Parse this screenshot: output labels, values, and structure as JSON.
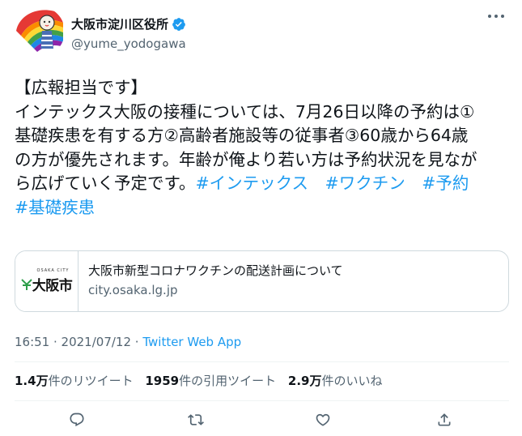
{
  "account": {
    "display_name": "大阪市淀川区役所",
    "handle": "@yume_yodogawa"
  },
  "tweet": {
    "lines": [
      [
        {
          "t": "【広報担当です】",
          "h": false
        }
      ],
      [
        {
          "t": "インテックス大阪の接種については、7月26日以降の予約は①",
          "h": false
        }
      ],
      [
        {
          "t": "基礎疾患を有する方②高齢者施設等の従事者③60歳から64歳",
          "h": false
        }
      ],
      [
        {
          "t": "の方が優先されます。年齢が俺より若い方は予約状況を見なが",
          "h": false
        }
      ],
      [
        {
          "t": "ら広げていく予定です。",
          "h": false
        },
        {
          "t": "#インテックス",
          "h": true
        },
        {
          "t": "　",
          "h": false
        },
        {
          "t": "#ワクチン",
          "h": true
        },
        {
          "t": "　",
          "h": false
        },
        {
          "t": "#予約",
          "h": true
        }
      ],
      [
        {
          "t": "#基礎疾患",
          "h": true
        }
      ]
    ]
  },
  "card": {
    "logo_small": "OSAKA CITY",
    "logo_text": "大阪市",
    "title": "大阪市新型コロナワクチンの配送計画について",
    "domain": "city.osaka.lg.jp"
  },
  "meta": {
    "time": "16:51",
    "sep1": " · ",
    "date": "2021/07/12",
    "sep2": " · ",
    "source": "Twitter Web App"
  },
  "stats": {
    "retweets_count": "1.4万",
    "retweets_label": "件のリツイート",
    "quotes_count": "1959",
    "quotes_label": "件の引用ツイート",
    "likes_count": "2.9万",
    "likes_label": "件のいいね"
  },
  "colors": {
    "accent": "#1d9bf0",
    "secondary_text": "#536471",
    "primary_text": "#0f1419",
    "border": "#cfd9de"
  },
  "icons": {
    "verified": "verified-badge-icon",
    "more": "more-dots-icon",
    "reply": "reply-icon",
    "retweet": "retweet-icon",
    "like": "heart-icon",
    "share": "share-icon"
  }
}
